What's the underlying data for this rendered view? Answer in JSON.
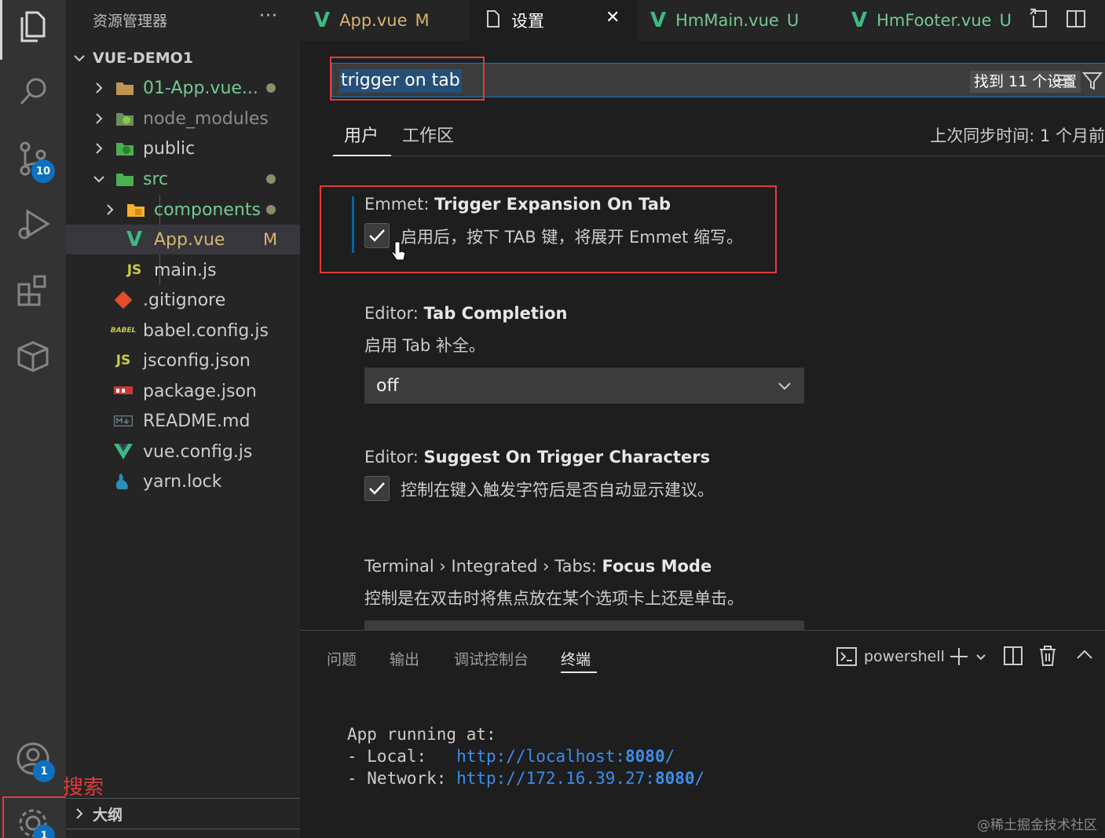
{
  "sidebar": {
    "title": "资源管理器",
    "more": "···",
    "project": "VUE-DEMO1",
    "items": [
      {
        "label": "01-App.vue..."
      },
      {
        "label": "node_modules"
      },
      {
        "label": "public"
      },
      {
        "label": "src"
      },
      {
        "label": "components"
      },
      {
        "label": "App.vue",
        "status": "M"
      },
      {
        "label": "main.js"
      },
      {
        "label": ".gitignore"
      },
      {
        "label": "babel.config.js"
      },
      {
        "label": "jsconfig.json"
      },
      {
        "label": "package.json"
      },
      {
        "label": "README.md"
      },
      {
        "label": "vue.config.js"
      },
      {
        "label": "yarn.lock"
      }
    ],
    "outline": "大纲"
  },
  "activity": {
    "scm_badge": "10",
    "account_badge": "1",
    "settings_badge": "1"
  },
  "tabs": [
    {
      "label": "App.vue",
      "status": "M"
    },
    {
      "label": "设置",
      "close": "✕"
    },
    {
      "label": "HmMain.vue",
      "status": "U"
    },
    {
      "label": "HmFooter.vue",
      "status": "U"
    }
  ],
  "settings": {
    "search_value": "trigger on tab",
    "found": "找到 11 个设置",
    "tab_user": "用户",
    "tab_workspace": "工作区",
    "sync": "上次同步时间: 1 个月前",
    "items": [
      {
        "category": "Emmet: ",
        "name": "Trigger Expansion On Tab",
        "desc": "启用后，按下 TAB 键，将展开 Emmet 缩写。",
        "checked": true
      },
      {
        "category": "Editor: ",
        "name": "Tab Completion",
        "desc": "启用 Tab 补全。",
        "value": "off"
      },
      {
        "category": "Editor: ",
        "name": "Suggest On Trigger Characters",
        "desc": "控制在键入触发字符后是否自动显示建议。",
        "checked": true
      },
      {
        "category": "Terminal › Integrated › Tabs: ",
        "name": "Focus Mode",
        "desc": "控制是在双击时将焦点放在某个选项卡上还是单击。"
      }
    ]
  },
  "panel": {
    "tabs": [
      "问题",
      "输出",
      "调试控制台",
      "终端"
    ],
    "shell": "powershell",
    "terminal": {
      "line1": "App running at:",
      "local_label": "- Local:   ",
      "local_url": "http://localhost:",
      "local_port": "8080",
      "local_end": "/",
      "network_label": "- Network: ",
      "network_url": "http://172.16.39.27:",
      "network_port": "8080",
      "network_end": "/"
    }
  },
  "annotation": "搜索",
  "watermark": "@稀土掘金技术社区",
  "colors": {
    "accent": "#0e70c0",
    "vue": "#41b883",
    "highlight_box": "#e23b3b",
    "modified": "#d7b56d"
  }
}
